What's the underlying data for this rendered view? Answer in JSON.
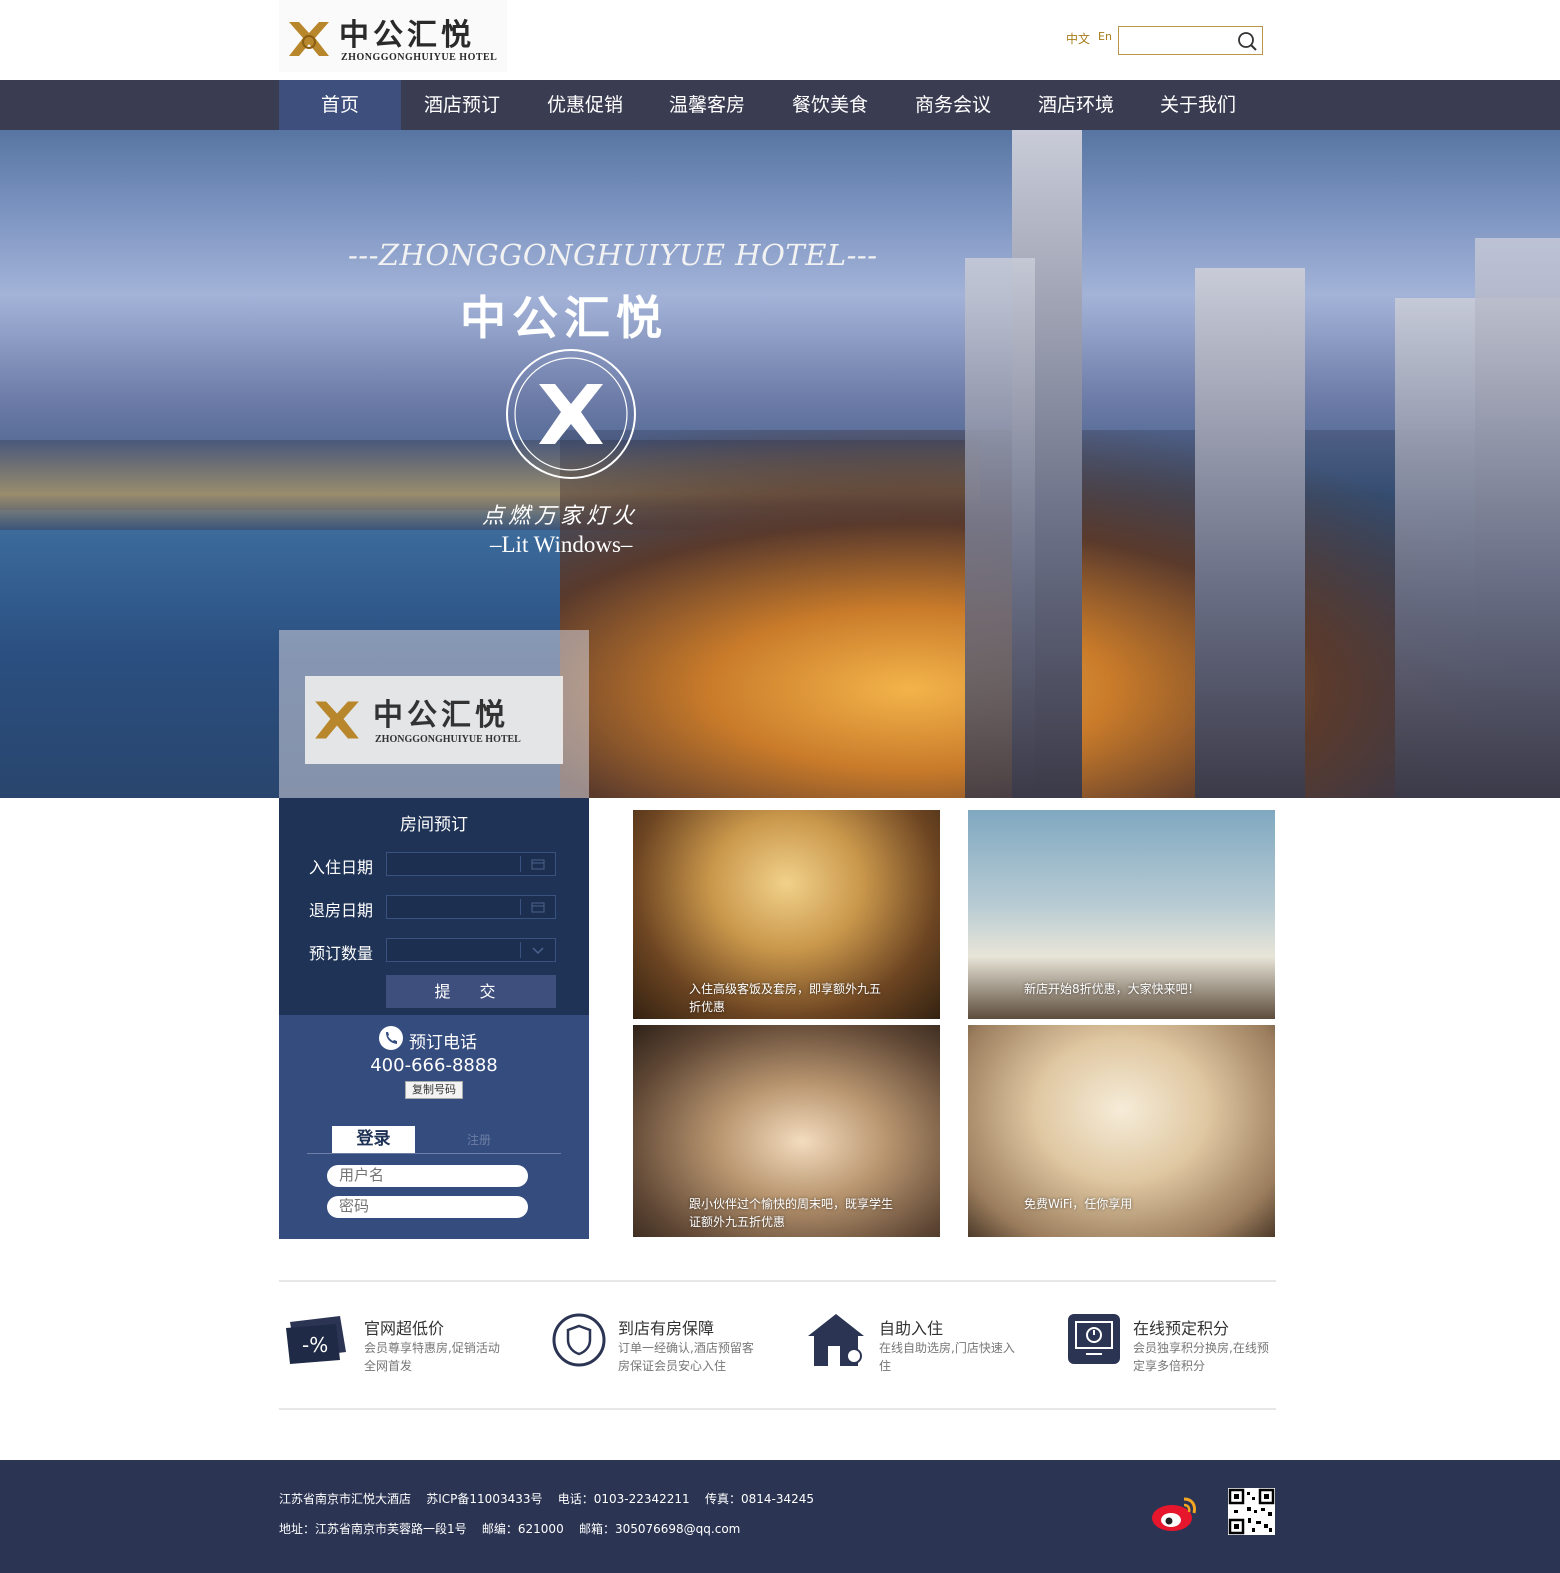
{
  "header": {
    "logo_cn": "中公汇悦",
    "logo_en": "ZHONGGONGHUIYUE HOTEL",
    "lang_cn": "中文",
    "lang_en": "En",
    "search_placeholder": ""
  },
  "nav": {
    "items": [
      "首页",
      "酒店预订",
      "优惠促销",
      "温馨客房",
      "餐饮美食",
      "商务会议",
      "酒店环境",
      "关于我们"
    ]
  },
  "hero": {
    "slogan_en": "---ZHONGGONGHUIYUE HOTEL---",
    "slogan_cn": "中公汇悦",
    "tagline_cn": "点燃万家灯火",
    "tagline_en": "–Lit Windows–",
    "panel_cn": "中公汇悦",
    "panel_en": "ZHONGGONGHUIYUE HOTEL"
  },
  "booking": {
    "title": "房间预订",
    "checkin_label": "入住日期",
    "checkout_label": "退房日期",
    "quantity_label": "预订数量",
    "submit_label": "提 交"
  },
  "phone": {
    "label": "预订电话",
    "number": "400-666-8888",
    "copy_label": "复制号码"
  },
  "login": {
    "tab_login": "登录",
    "tab_register": "注册",
    "username_placeholder": "用户名",
    "password_placeholder": "密码"
  },
  "gallery": [
    {
      "caption": "入住高级客饭及套房，即享额外九五折优惠"
    },
    {
      "caption": "新店开始8折优惠，大家快来吧！"
    },
    {
      "caption": "跟小伙伴过个愉快的周末吧，既享学生证额外九五折优惠"
    },
    {
      "caption": "免费WiFi，任你享用"
    }
  ],
  "features": [
    {
      "title": "官网超低价",
      "desc_line1": "会员尊享特惠房,促销活动",
      "desc_line2": "全网首发",
      "icon": "discount-ticket-icon"
    },
    {
      "title": "到店有房保障",
      "desc_line1": "订单一经确认,酒店预留客",
      "desc_line2": "房保证会员安心入住",
      "icon": "shield-icon"
    },
    {
      "title": "自助入住",
      "desc_line1": "在线自助选房,门店快速入",
      "desc_line2": "住",
      "icon": "house-key-icon"
    },
    {
      "title": "在线预定积分",
      "desc_line1": "会员独享积分换房,在线预",
      "desc_line2": "定享多倍积分",
      "icon": "monitor-clock-icon"
    }
  ],
  "footer": {
    "line1": "江苏省南京市汇悦大酒店    苏ICP备11003433号    电话：0103-22342211    传真：0814-34245",
    "line2": "地址：江苏省南京市芙蓉路一段1号    邮编：621000    邮箱：305076698@qq.com"
  },
  "colors": {
    "nav_bg": "#3a3d52",
    "nav_active": "#3e4f7e",
    "booking_bg": "#1f3356",
    "login_bg": "#354c7e",
    "footer_bg": "#2b3453",
    "gold": "#a67c1b"
  }
}
